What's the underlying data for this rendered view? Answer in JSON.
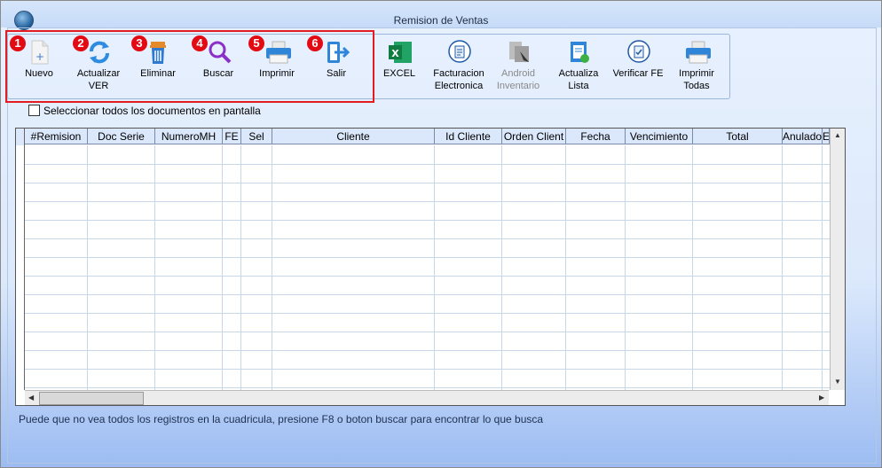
{
  "window": {
    "title": "Remision de Ventas"
  },
  "toolbar": {
    "buttons": [
      {
        "label": "Nuevo",
        "badge": "1",
        "icon": "new-document-icon"
      },
      {
        "label": "Actualizar\nVER",
        "badge": "2",
        "icon": "refresh-icon"
      },
      {
        "label": "Eliminar",
        "badge": "3",
        "icon": "trash-icon"
      },
      {
        "label": "Buscar",
        "badge": "4",
        "icon": "search-icon"
      },
      {
        "label": "Imprimir",
        "badge": "5",
        "icon": "printer-icon"
      },
      {
        "label": "Salir",
        "badge": "6",
        "icon": "exit-icon"
      },
      {
        "label": "EXCEL",
        "icon": "excel-icon"
      },
      {
        "label": "Facturacion\nElectronica",
        "icon": "e-invoice-icon"
      },
      {
        "label": "Android\nInventario",
        "icon": "android-inventory-icon"
      },
      {
        "label": "Actualiza\nLista",
        "icon": "update-list-icon"
      },
      {
        "label": "Verificar FE",
        "icon": "verify-fe-icon"
      },
      {
        "label": "Imprimir\nTodas",
        "icon": "print-all-icon"
      }
    ],
    "highlight_color": "#e31b23"
  },
  "select_all": {
    "label": "Seleccionar todos los documentos en pantalla",
    "checked": false
  },
  "grid": {
    "columns": [
      "#Remision",
      "Doc Serie",
      "NumeroMH",
      "FE",
      "Sel",
      "Cliente",
      "Id Cliente",
      "Orden Client",
      "Fecha",
      "Vencimiento",
      "Total",
      "Anulado",
      "E"
    ],
    "rows": []
  },
  "footer": {
    "message": "Puede que no vea todos los registros en la cuadricula, presione F8 o boton buscar para encontrar lo que busca"
  }
}
